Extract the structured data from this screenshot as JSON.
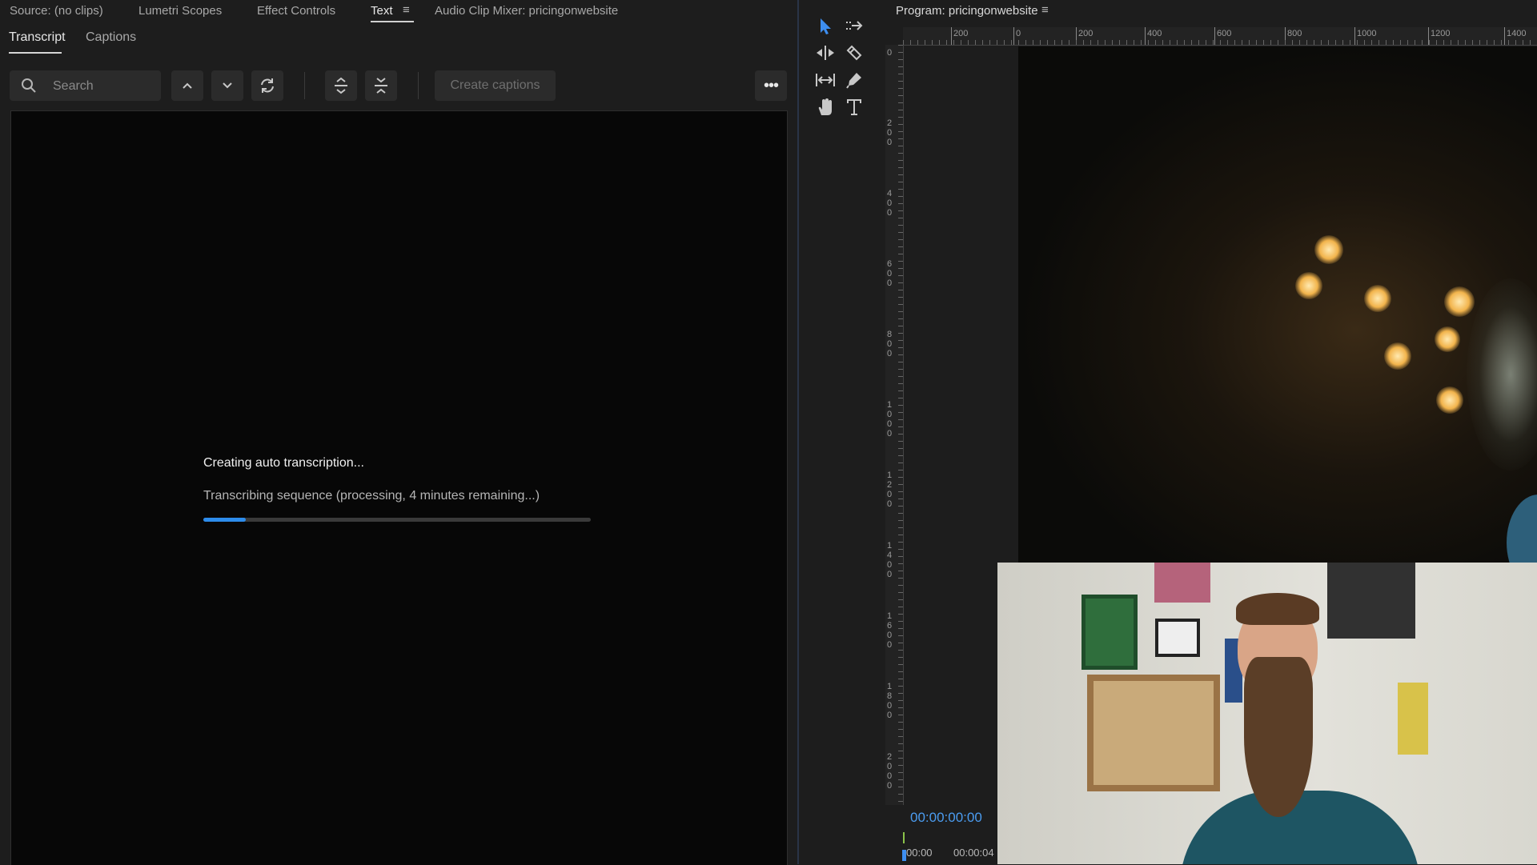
{
  "panel_tabs": {
    "source": "Source: (no clips)",
    "lumetri": "Lumetri Scopes",
    "effect_controls": "Effect Controls",
    "text": "Text",
    "audio_mixer": "Audio Clip Mixer: pricingonwebsite"
  },
  "sub_tabs": {
    "transcript": "Transcript",
    "captions": "Captions"
  },
  "toolbar": {
    "search_placeholder": "Search",
    "create_captions": "Create captions",
    "icons": [
      "search-icon",
      "chevron-up-icon",
      "chevron-down-icon",
      "refresh-icon",
      "expand-icon",
      "collapse-icon",
      "more-icon"
    ]
  },
  "transcription": {
    "title": "Creating auto transcription...",
    "status": "Transcribing sequence (processing, 4 minutes remaining...)",
    "progress": 0.11,
    "progress_color": "#2d8ceb"
  },
  "tools": [
    "selection-tool-icon",
    "track-select-icon",
    "ripple-edit-icon",
    "razor-icon",
    "slip-icon",
    "pen-icon",
    "hand-icon",
    "type-icon"
  ],
  "program": {
    "title": "Program: pricingonwebsite",
    "timecode": "00:00:00:00",
    "timecode_color": "#4b9cf0",
    "ruler_h_labels": [
      "200",
      "0",
      "200",
      "400",
      "600",
      "800",
      "1000",
      "1200",
      "1400"
    ],
    "ruler_v_labels": [
      "0",
      "200",
      "400",
      "600",
      "800",
      "1000",
      "1200",
      "1400",
      "1600",
      "1800",
      "2000"
    ],
    "timeline_ticks": [
      "00:00",
      "00:00:04"
    ]
  }
}
